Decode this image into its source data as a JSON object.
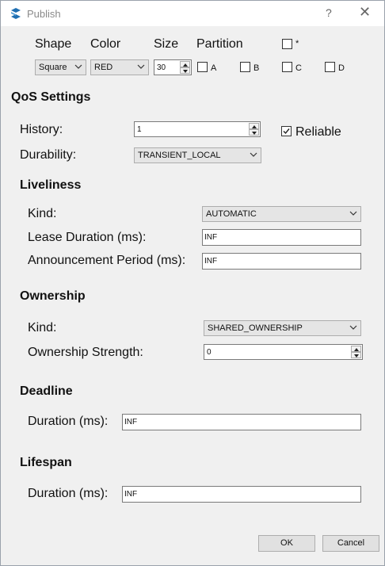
{
  "window": {
    "title": "Publish",
    "help_glyph": "?",
    "close_glyph": "✕"
  },
  "topic": {
    "shape_label": "Shape",
    "color_label": "Color",
    "size_label": "Size",
    "partition_label": "Partition",
    "shape_value": "Square",
    "color_value": "RED",
    "size_value": "30",
    "partitions": [
      {
        "label": "*",
        "checked": false
      },
      {
        "label": "A",
        "checked": false
      },
      {
        "label": "B",
        "checked": false
      },
      {
        "label": "C",
        "checked": false
      },
      {
        "label": "D",
        "checked": false
      }
    ]
  },
  "qos": {
    "heading": "QoS Settings",
    "history_label": "History:",
    "history_value": "1",
    "reliable_label": "Reliable",
    "reliable_checked": true,
    "durability_label": "Durability:",
    "durability_value": "TRANSIENT_LOCAL"
  },
  "liveliness": {
    "heading": "Liveliness",
    "kind_label": "Kind:",
    "kind_value": "AUTOMATIC",
    "lease_label": "Lease Duration (ms):",
    "lease_value": "INF",
    "announcement_label": "Announcement Period (ms):",
    "announcement_value": "INF"
  },
  "ownership": {
    "heading": "Ownership",
    "kind_label": "Kind:",
    "kind_value": "SHARED_OWNERSHIP",
    "strength_label": "Ownership Strength:",
    "strength_value": "0"
  },
  "deadline": {
    "heading": "Deadline",
    "duration_label": "Duration (ms):",
    "duration_value": "INF"
  },
  "lifespan": {
    "heading": "Lifespan",
    "duration_label": "Duration (ms):",
    "duration_value": "INF"
  },
  "buttons": {
    "ok": "OK",
    "cancel": "Cancel"
  }
}
